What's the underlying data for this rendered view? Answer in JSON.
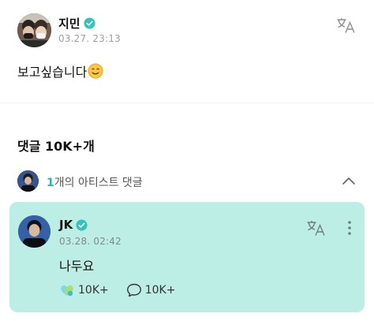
{
  "post": {
    "author": "지민",
    "time": "03.27. 23:13",
    "text": "보고싶습니다"
  },
  "comments": {
    "title": "댓글 10K+개",
    "artist_count": "1",
    "artist_label": "개의 아티스트 댓글"
  },
  "artist_comment": {
    "author": "JK",
    "time": "03.28. 02:42",
    "text": "나두요",
    "like_count": "10K+",
    "reply_count": "10K+"
  },
  "colors": {
    "accent": "#1fb8b0",
    "card_background": "#bdeee5",
    "verified_badge": "#2ec4c0"
  },
  "icons": {
    "translate": "translate-icon",
    "verified": "verified-badge-icon",
    "chevron": "chevron-up-icon",
    "more": "more-vertical-icon",
    "like": "like-reaction-icon",
    "reply": "speech-bubble-icon",
    "emoji": "smiling-face-emoji"
  }
}
